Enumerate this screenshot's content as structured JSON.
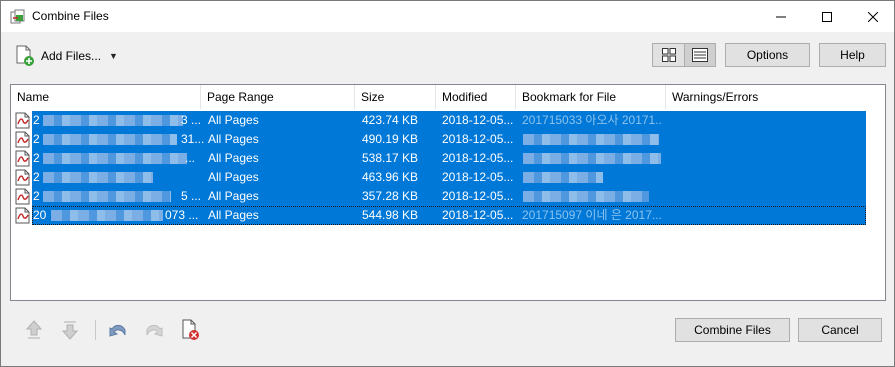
{
  "window": {
    "title": "Combine Files"
  },
  "toolbar": {
    "add_files_label": "Add Files...",
    "options_label": "Options",
    "help_label": "Help"
  },
  "table": {
    "columns": [
      "Name",
      "Page Range",
      "Size",
      "Modified",
      "Bookmark for File",
      "Warnings/Errors"
    ],
    "rows": [
      {
        "name": "2",
        "name_tail": "3 ...",
        "page_range": "All Pages",
        "size": "423.74 KB",
        "modified": "2018-12-05...",
        "bookmark": "201715033 아오사 20171...",
        "warnings": ""
      },
      {
        "name": "2",
        "name_tail": "31...",
        "page_range": "All Pages",
        "size": "490.19 KB",
        "modified": "2018-12-05...",
        "bookmark": "",
        "warnings": ""
      },
      {
        "name": "2",
        "name_tail": "...",
        "page_range": "All Pages",
        "size": "538.17 KB",
        "modified": "2018-12-05...",
        "bookmark": "",
        "warnings": ""
      },
      {
        "name": "2",
        "name_tail": "",
        "page_range": "All Pages",
        "size": "463.96 KB",
        "modified": "2018-12-05...",
        "bookmark": "",
        "warnings": ""
      },
      {
        "name": "2",
        "name_tail": "5 ...",
        "page_range": "All Pages",
        "size": "357.28 KB",
        "modified": "2018-12-05...",
        "bookmark": "",
        "warnings": ""
      },
      {
        "name": "20",
        "name_tail": "073 ...",
        "page_range": "All Pages",
        "size": "544.98 KB",
        "modified": "2018-12-05...",
        "bookmark": "201715097 이네 은 2017...",
        "warnings": ""
      }
    ]
  },
  "footer": {
    "combine_label": "Combine Files",
    "cancel_label": "Cancel"
  },
  "colors": {
    "selection": "#0078d7",
    "accent_pdf": "#c62828"
  }
}
